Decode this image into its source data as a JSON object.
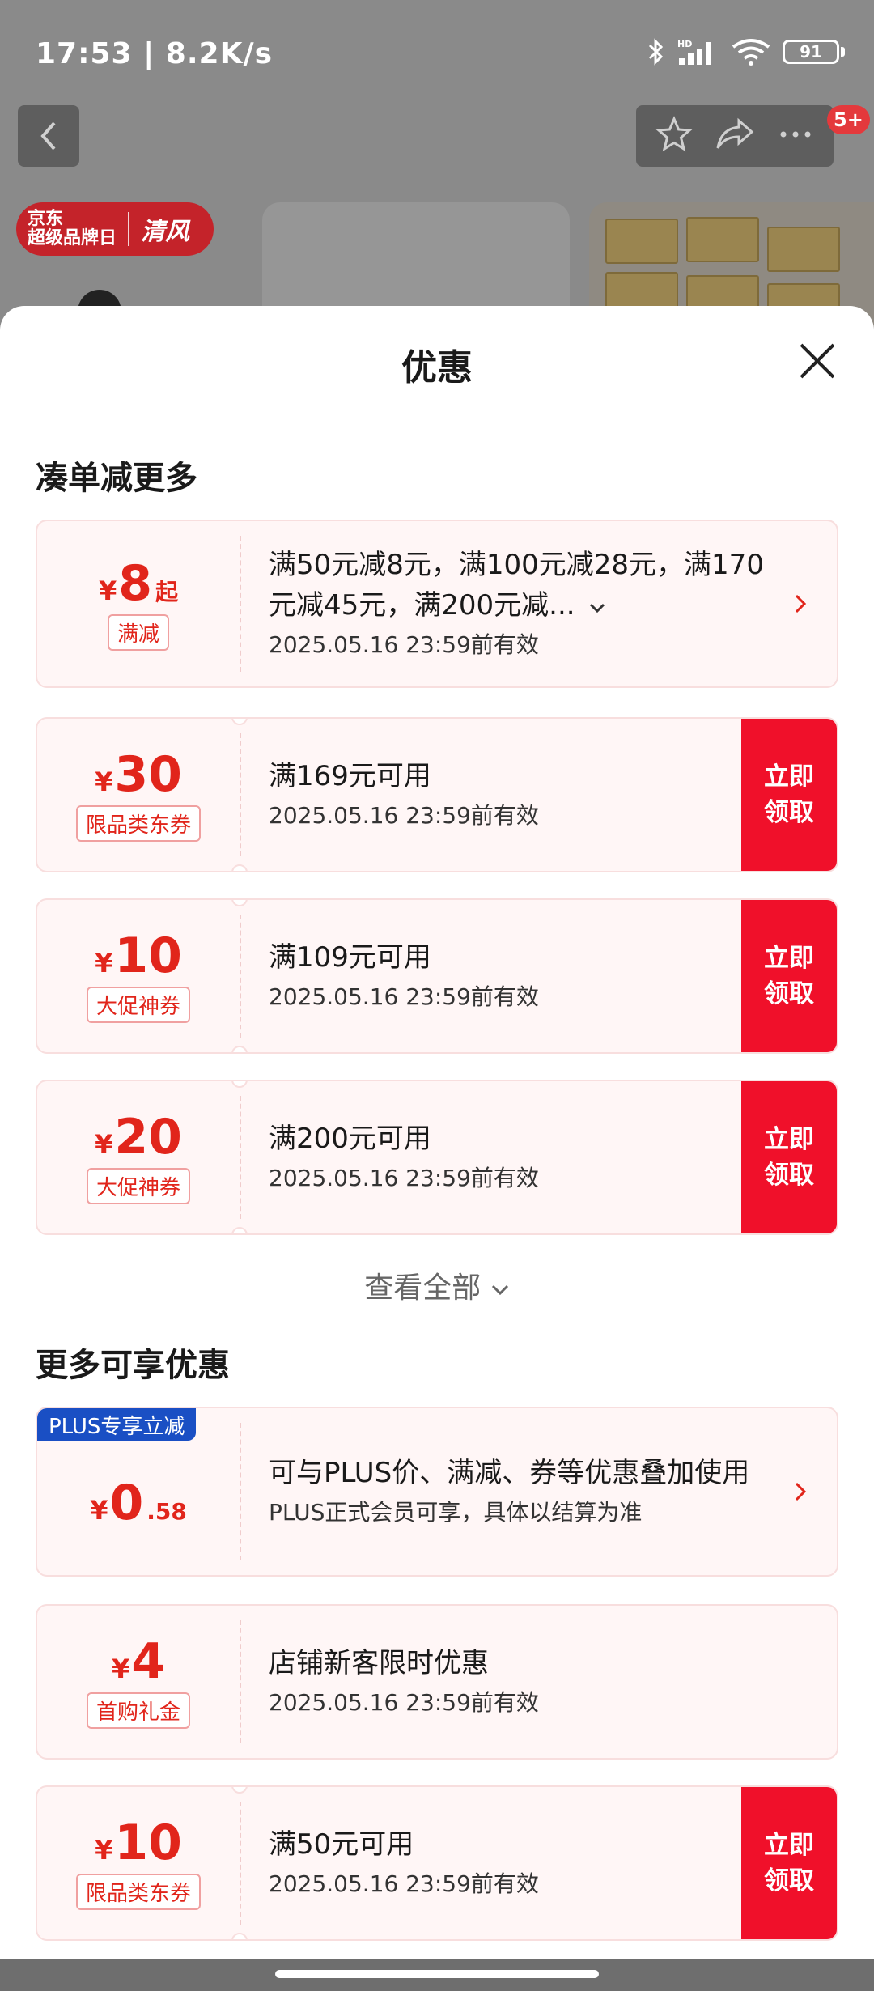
{
  "status_bar": {
    "time": "17:53 | 8.2K/s",
    "battery": "91",
    "icons": [
      "bluetooth-icon",
      "hd-signal-icon",
      "wifi-icon",
      "battery-icon"
    ]
  },
  "top_nav": {
    "badge": "5+",
    "icons": [
      "back-icon",
      "star-icon",
      "share-icon",
      "more-icon"
    ]
  },
  "brand_banner": {
    "left_line1": "京东",
    "left_line2": "超级品牌日",
    "right": "清风"
  },
  "sheet": {
    "title": "优惠",
    "section1_title": "凑单减更多",
    "section2_title": "更多可享优惠",
    "view_all": "查看全部"
  },
  "coupons_section1": [
    {
      "yen": "¥",
      "amount": "8",
      "suffix": "起",
      "tag": "满减",
      "main": "满50元减8元，满100元减28元，满170元减45元，满200元减...",
      "sub": "2025.05.16 23:59前有效"
    },
    {
      "yen": "¥",
      "amount": "30",
      "tag": "限品类东券",
      "main": "满169元可用",
      "sub": "2025.05.16 23:59前有效",
      "button": "立即领取"
    },
    {
      "yen": "¥",
      "amount": "10",
      "tag": "大促神券",
      "main": "满109元可用",
      "sub": "2025.05.16 23:59前有效",
      "button": "立即领取"
    },
    {
      "yen": "¥",
      "amount": "20",
      "tag": "大促神券",
      "main": "满200元可用",
      "sub": "2025.05.16 23:59前有效",
      "button": "立即领取"
    }
  ],
  "coupons_section2": [
    {
      "badge": "PLUS专享立减",
      "yen": "¥",
      "amount": "0",
      "suffix": ".58",
      "main": "可与PLUS价、满减、券等优惠叠加使用",
      "sub": "PLUS正式会员可享，具体以结算为准"
    },
    {
      "yen": "¥",
      "amount": "4",
      "tag": "首购礼金",
      "main": "店铺新客限时优惠",
      "sub": "2025.05.16 23:59前有效"
    },
    {
      "yen": "¥",
      "amount": "10",
      "tag": "限品类东券",
      "main": "满50元可用",
      "sub": "2025.05.16 23:59前有效",
      "button": "立即领取"
    }
  ],
  "colors": {
    "accent_red": "#f0102a",
    "price_red": "#e1251b",
    "coupon_bg": "#fff6f6",
    "plus_blue": "#1a4fc4"
  }
}
